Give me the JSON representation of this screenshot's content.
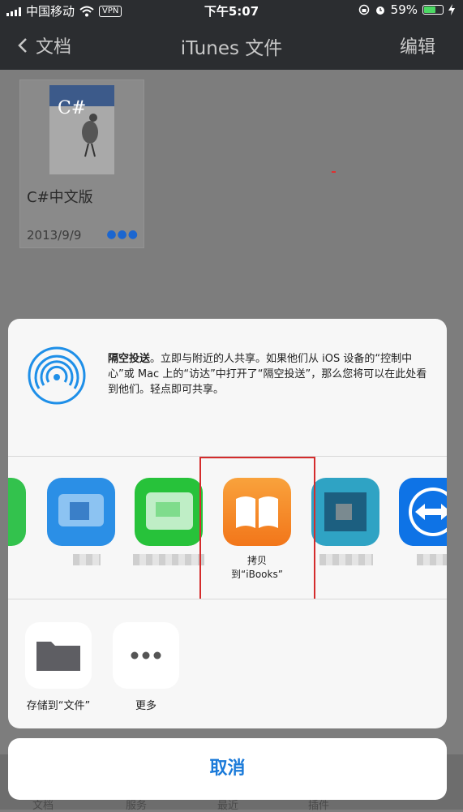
{
  "status_bar": {
    "carrier": "中国移动",
    "vpn": "VPN",
    "time": "下午5:07",
    "battery": "59%",
    "battery_level": 0.59
  },
  "nav": {
    "back_label": "文档",
    "title": "iTunes 文件",
    "edit_label": "编辑"
  },
  "file": {
    "name": "C#中文版",
    "date": "2013/9/9",
    "cover_text": "C#"
  },
  "tab_bar": {
    "items": [
      "文档",
      "服务",
      "最近",
      "插件"
    ]
  },
  "airdrop": {
    "title": "隔空投送",
    "description": "。立即与附近的人共享。如果他们从 iOS 设备的“控制中心”或 Mac 上的“访达”中打开了“隔空投送”，那么您将可以在此处看到他们。轻点即可共享。"
  },
  "apps": {
    "ibooks_label_line1": "拷贝",
    "ibooks_label_line2": "到“iBooks”"
  },
  "actions": {
    "save_to_files": "存储到“文件”",
    "more": "更多"
  },
  "cancel_label": "取消",
  "colors": {
    "accent": "#1a7ad9",
    "highlight": "#d42c2c",
    "ibooks": "#f58a1f"
  }
}
